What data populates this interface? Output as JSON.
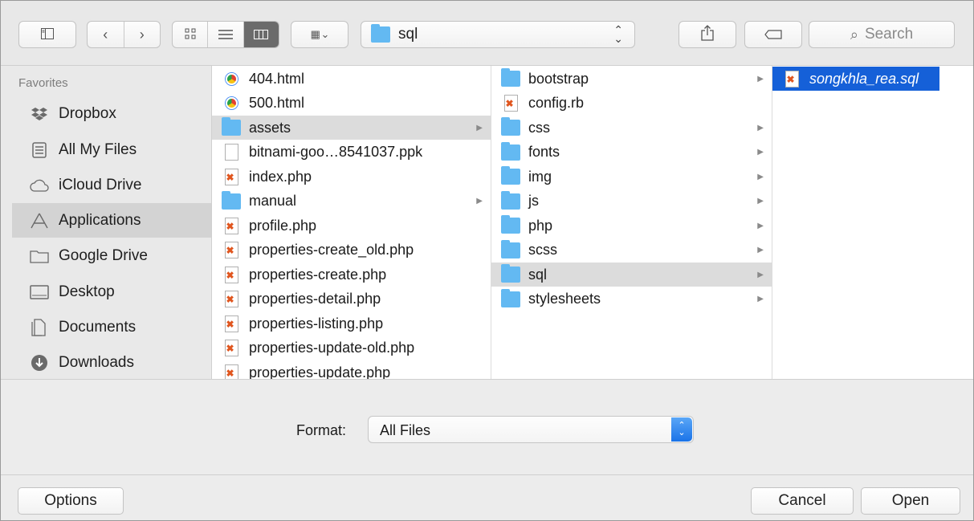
{
  "toolbar": {
    "path_label": "sql",
    "search_placeholder": "Search",
    "icons": {
      "sidebar_toggle": "sidebar-icon",
      "back": "chevron-left-icon",
      "forward": "chevron-right-icon",
      "view_icons": "grid-icon",
      "view_list": "list-icon",
      "view_columns": "columns-icon",
      "arrange": "arrange-icon",
      "share": "share-icon",
      "tags": "tag-icon",
      "search": "search-icon"
    }
  },
  "sidebar": {
    "heading": "Favorites",
    "items": [
      {
        "label": "Dropbox",
        "icon": "dropbox-icon"
      },
      {
        "label": "All My Files",
        "icon": "all-files-icon"
      },
      {
        "label": "iCloud Drive",
        "icon": "cloud-icon"
      },
      {
        "label": "Applications",
        "icon": "applications-icon",
        "selected": true
      },
      {
        "label": "Google Drive",
        "icon": "folder-icon"
      },
      {
        "label": "Desktop",
        "icon": "desktop-icon"
      },
      {
        "label": "Documents",
        "icon": "documents-icon"
      },
      {
        "label": "Downloads",
        "icon": "download-icon"
      }
    ]
  },
  "columns": {
    "col1": [
      {
        "name": "404.html",
        "type": "html"
      },
      {
        "name": "500.html",
        "type": "html"
      },
      {
        "name": "assets",
        "type": "folder",
        "selected": true
      },
      {
        "name": "bitnami-goo…8541037.ppk",
        "type": "file"
      },
      {
        "name": "index.php",
        "type": "php"
      },
      {
        "name": "manual",
        "type": "folder"
      },
      {
        "name": "profile.php",
        "type": "php"
      },
      {
        "name": "properties-create_old.php",
        "type": "php"
      },
      {
        "name": "properties-create.php",
        "type": "php"
      },
      {
        "name": "properties-detail.php",
        "type": "php"
      },
      {
        "name": "properties-listing.php",
        "type": "php"
      },
      {
        "name": "properties-update-old.php",
        "type": "php"
      },
      {
        "name": "properties-update.php",
        "type": "php"
      }
    ],
    "col2": [
      {
        "name": "bootstrap",
        "type": "folder"
      },
      {
        "name": "config.rb",
        "type": "php"
      },
      {
        "name": "css",
        "type": "folder"
      },
      {
        "name": "fonts",
        "type": "folder"
      },
      {
        "name": "img",
        "type": "folder"
      },
      {
        "name": "js",
        "type": "folder"
      },
      {
        "name": "php",
        "type": "folder"
      },
      {
        "name": "scss",
        "type": "folder"
      },
      {
        "name": "sql",
        "type": "folder",
        "selected": true
      },
      {
        "name": "stylesheets",
        "type": "folder"
      }
    ],
    "col3": [
      {
        "name": "songkhla_rea.sql",
        "type": "php",
        "selected": true
      }
    ]
  },
  "format": {
    "label": "Format:",
    "value": "All Files"
  },
  "buttons": {
    "options": "Options",
    "cancel": "Cancel",
    "open": "Open"
  },
  "colors": {
    "selection_blue": "#1560d8",
    "folder_blue": "#63b9f2",
    "accent_blue": "#1a73e8"
  }
}
